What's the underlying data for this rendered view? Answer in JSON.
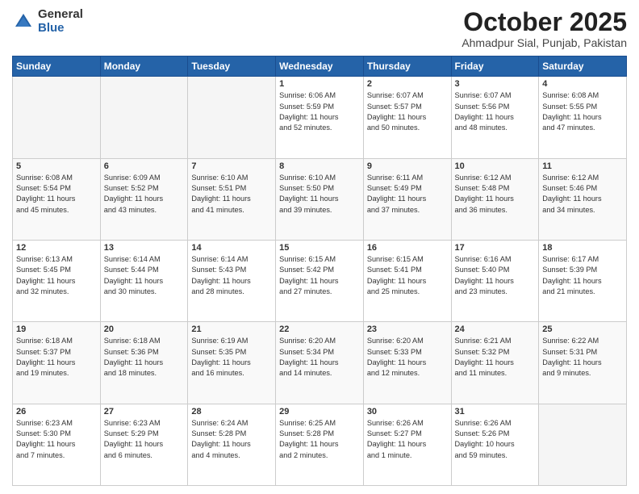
{
  "logo": {
    "general": "General",
    "blue": "Blue"
  },
  "header": {
    "month": "October 2025",
    "location": "Ahmadpur Sial, Punjab, Pakistan"
  },
  "weekdays": [
    "Sunday",
    "Monday",
    "Tuesday",
    "Wednesday",
    "Thursday",
    "Friday",
    "Saturday"
  ],
  "weeks": [
    [
      {
        "day": "",
        "info": ""
      },
      {
        "day": "",
        "info": ""
      },
      {
        "day": "",
        "info": ""
      },
      {
        "day": "1",
        "info": "Sunrise: 6:06 AM\nSunset: 5:59 PM\nDaylight: 11 hours\nand 52 minutes."
      },
      {
        "day": "2",
        "info": "Sunrise: 6:07 AM\nSunset: 5:57 PM\nDaylight: 11 hours\nand 50 minutes."
      },
      {
        "day": "3",
        "info": "Sunrise: 6:07 AM\nSunset: 5:56 PM\nDaylight: 11 hours\nand 48 minutes."
      },
      {
        "day": "4",
        "info": "Sunrise: 6:08 AM\nSunset: 5:55 PM\nDaylight: 11 hours\nand 47 minutes."
      }
    ],
    [
      {
        "day": "5",
        "info": "Sunrise: 6:08 AM\nSunset: 5:54 PM\nDaylight: 11 hours\nand 45 minutes."
      },
      {
        "day": "6",
        "info": "Sunrise: 6:09 AM\nSunset: 5:52 PM\nDaylight: 11 hours\nand 43 minutes."
      },
      {
        "day": "7",
        "info": "Sunrise: 6:10 AM\nSunset: 5:51 PM\nDaylight: 11 hours\nand 41 minutes."
      },
      {
        "day": "8",
        "info": "Sunrise: 6:10 AM\nSunset: 5:50 PM\nDaylight: 11 hours\nand 39 minutes."
      },
      {
        "day": "9",
        "info": "Sunrise: 6:11 AM\nSunset: 5:49 PM\nDaylight: 11 hours\nand 37 minutes."
      },
      {
        "day": "10",
        "info": "Sunrise: 6:12 AM\nSunset: 5:48 PM\nDaylight: 11 hours\nand 36 minutes."
      },
      {
        "day": "11",
        "info": "Sunrise: 6:12 AM\nSunset: 5:46 PM\nDaylight: 11 hours\nand 34 minutes."
      }
    ],
    [
      {
        "day": "12",
        "info": "Sunrise: 6:13 AM\nSunset: 5:45 PM\nDaylight: 11 hours\nand 32 minutes."
      },
      {
        "day": "13",
        "info": "Sunrise: 6:14 AM\nSunset: 5:44 PM\nDaylight: 11 hours\nand 30 minutes."
      },
      {
        "day": "14",
        "info": "Sunrise: 6:14 AM\nSunset: 5:43 PM\nDaylight: 11 hours\nand 28 minutes."
      },
      {
        "day": "15",
        "info": "Sunrise: 6:15 AM\nSunset: 5:42 PM\nDaylight: 11 hours\nand 27 minutes."
      },
      {
        "day": "16",
        "info": "Sunrise: 6:15 AM\nSunset: 5:41 PM\nDaylight: 11 hours\nand 25 minutes."
      },
      {
        "day": "17",
        "info": "Sunrise: 6:16 AM\nSunset: 5:40 PM\nDaylight: 11 hours\nand 23 minutes."
      },
      {
        "day": "18",
        "info": "Sunrise: 6:17 AM\nSunset: 5:39 PM\nDaylight: 11 hours\nand 21 minutes."
      }
    ],
    [
      {
        "day": "19",
        "info": "Sunrise: 6:18 AM\nSunset: 5:37 PM\nDaylight: 11 hours\nand 19 minutes."
      },
      {
        "day": "20",
        "info": "Sunrise: 6:18 AM\nSunset: 5:36 PM\nDaylight: 11 hours\nand 18 minutes."
      },
      {
        "day": "21",
        "info": "Sunrise: 6:19 AM\nSunset: 5:35 PM\nDaylight: 11 hours\nand 16 minutes."
      },
      {
        "day": "22",
        "info": "Sunrise: 6:20 AM\nSunset: 5:34 PM\nDaylight: 11 hours\nand 14 minutes."
      },
      {
        "day": "23",
        "info": "Sunrise: 6:20 AM\nSunset: 5:33 PM\nDaylight: 11 hours\nand 12 minutes."
      },
      {
        "day": "24",
        "info": "Sunrise: 6:21 AM\nSunset: 5:32 PM\nDaylight: 11 hours\nand 11 minutes."
      },
      {
        "day": "25",
        "info": "Sunrise: 6:22 AM\nSunset: 5:31 PM\nDaylight: 11 hours\nand 9 minutes."
      }
    ],
    [
      {
        "day": "26",
        "info": "Sunrise: 6:23 AM\nSunset: 5:30 PM\nDaylight: 11 hours\nand 7 minutes."
      },
      {
        "day": "27",
        "info": "Sunrise: 6:23 AM\nSunset: 5:29 PM\nDaylight: 11 hours\nand 6 minutes."
      },
      {
        "day": "28",
        "info": "Sunrise: 6:24 AM\nSunset: 5:28 PM\nDaylight: 11 hours\nand 4 minutes."
      },
      {
        "day": "29",
        "info": "Sunrise: 6:25 AM\nSunset: 5:28 PM\nDaylight: 11 hours\nand 2 minutes."
      },
      {
        "day": "30",
        "info": "Sunrise: 6:26 AM\nSunset: 5:27 PM\nDaylight: 11 hours\nand 1 minute."
      },
      {
        "day": "31",
        "info": "Sunrise: 6:26 AM\nSunset: 5:26 PM\nDaylight: 10 hours\nand 59 minutes."
      },
      {
        "day": "",
        "info": ""
      }
    ]
  ]
}
